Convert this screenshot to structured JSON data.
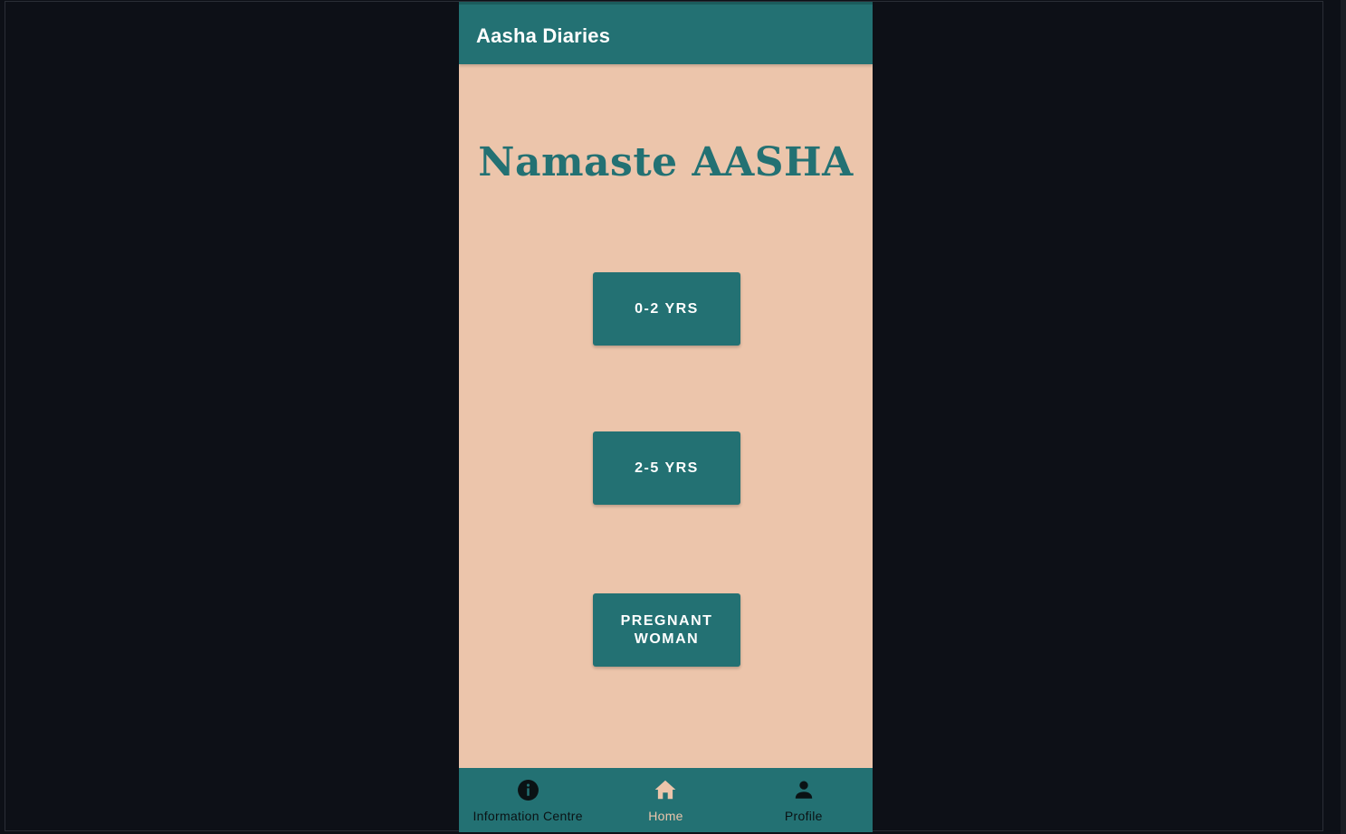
{
  "app": {
    "title": "Aasha Diaries"
  },
  "main": {
    "greeting": "Namaste AASHA",
    "buttons": [
      {
        "label": "0-2 YRS"
      },
      {
        "label": "2-5 YRS"
      },
      {
        "label": "PREGNANT WOMAN"
      }
    ]
  },
  "bottom_nav": {
    "items": [
      {
        "label": "Information Centre",
        "icon": "info-icon",
        "active": false
      },
      {
        "label": "Home",
        "icon": "home-icon",
        "active": true
      },
      {
        "label": "Profile",
        "icon": "person-icon",
        "active": false
      }
    ]
  },
  "colors": {
    "primary": "#237173",
    "background": "#ecc5ab",
    "desktop": "#0d1017",
    "active_nav": "#ecc5ab",
    "inactive_nav": "#0a1214"
  }
}
